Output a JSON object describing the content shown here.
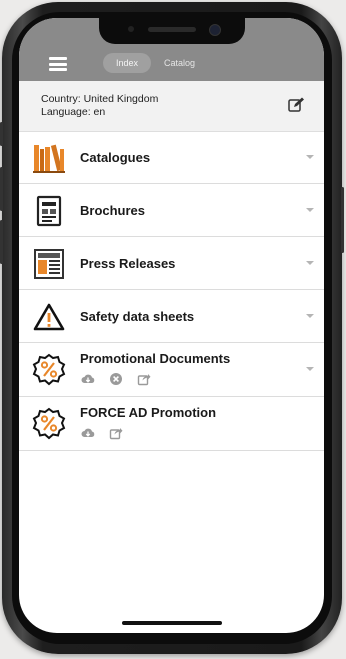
{
  "header": {
    "tabs": [
      {
        "label": "Index",
        "active": true
      },
      {
        "label": "Catalog",
        "active": false
      }
    ],
    "menu_icon": "hamburger-menu-icon"
  },
  "info": {
    "country": "Country: United Kingdom",
    "language": "Language: en",
    "edit_icon": "edit-icon"
  },
  "list": {
    "items": [
      {
        "label": "Catalogues",
        "icon": "catalogues-books-icon"
      },
      {
        "label": "Brochures",
        "icon": "brochure-icon"
      },
      {
        "label": "Press Releases",
        "icon": "newspaper-icon"
      },
      {
        "label": "Safety data sheets",
        "icon": "warning-triangle-icon"
      },
      {
        "label": "Promotional Documents",
        "icon": "percent-badge-icon",
        "actions": [
          "cloud-download-icon",
          "remove-circle-icon",
          "share-icon"
        ]
      },
      {
        "label": "FORCE AD Promotion",
        "icon": "percent-badge-icon",
        "actions": [
          "cloud-download-icon",
          "share-icon"
        ]
      }
    ]
  },
  "colors": {
    "header": "#8a8a8a",
    "accent_orange": "#e8872a",
    "info_bg": "#f2f2f2"
  }
}
